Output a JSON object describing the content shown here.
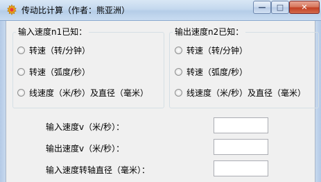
{
  "window": {
    "title": "传动比计算（作者：熊亚洲）",
    "controls": {
      "minimize": "—",
      "maximize": "□",
      "close": "✕"
    }
  },
  "input_group": {
    "legend": "输入速度n1已知：",
    "options": [
      {
        "label": "转速（转/分钟）",
        "selected": false
      },
      {
        "label": "转速（弧度/秒）",
        "selected": false
      },
      {
        "label": "线速度（米/秒）及直径（毫米）",
        "selected": false
      }
    ]
  },
  "output_group": {
    "legend": "输出速度n2已知：",
    "options": [
      {
        "label": "转速（转/分钟）",
        "selected": false
      },
      {
        "label": "转速（弧度/秒）",
        "selected": false
      },
      {
        "label": "线速度（米/秒）及直径（毫米）",
        "selected": false
      }
    ]
  },
  "fields": [
    {
      "label": "输入速度v（米/秒）：",
      "value": ""
    },
    {
      "label": "输出速度v（米/秒）：",
      "value": ""
    },
    {
      "label": "输入速度转轴直径（毫米）：",
      "value": ""
    }
  ],
  "icons": {
    "app": "gear-icon"
  },
  "colors": {
    "title_bar": "#c4d8ee",
    "close_button": "#c34125",
    "window_bg": "#f0f0f0"
  }
}
